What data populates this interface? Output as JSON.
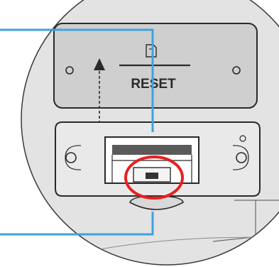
{
  "cover_panel": {
    "reset_label": "RESET",
    "icon": "sd-card-icon"
  },
  "callouts": [
    {
      "id": "usb-port-callout",
      "target": "usb-port"
    },
    {
      "id": "reset-button-callout",
      "target": "reset-button"
    }
  ],
  "highlight": {
    "target": "reset-button",
    "color": "#e8201f"
  },
  "colors": {
    "callout_line": "#3da3dd",
    "device_body": "#e3e3e3",
    "cover_panel": "#cfcfcf",
    "outline": "#2a2a2a",
    "background": "#ffffff"
  }
}
